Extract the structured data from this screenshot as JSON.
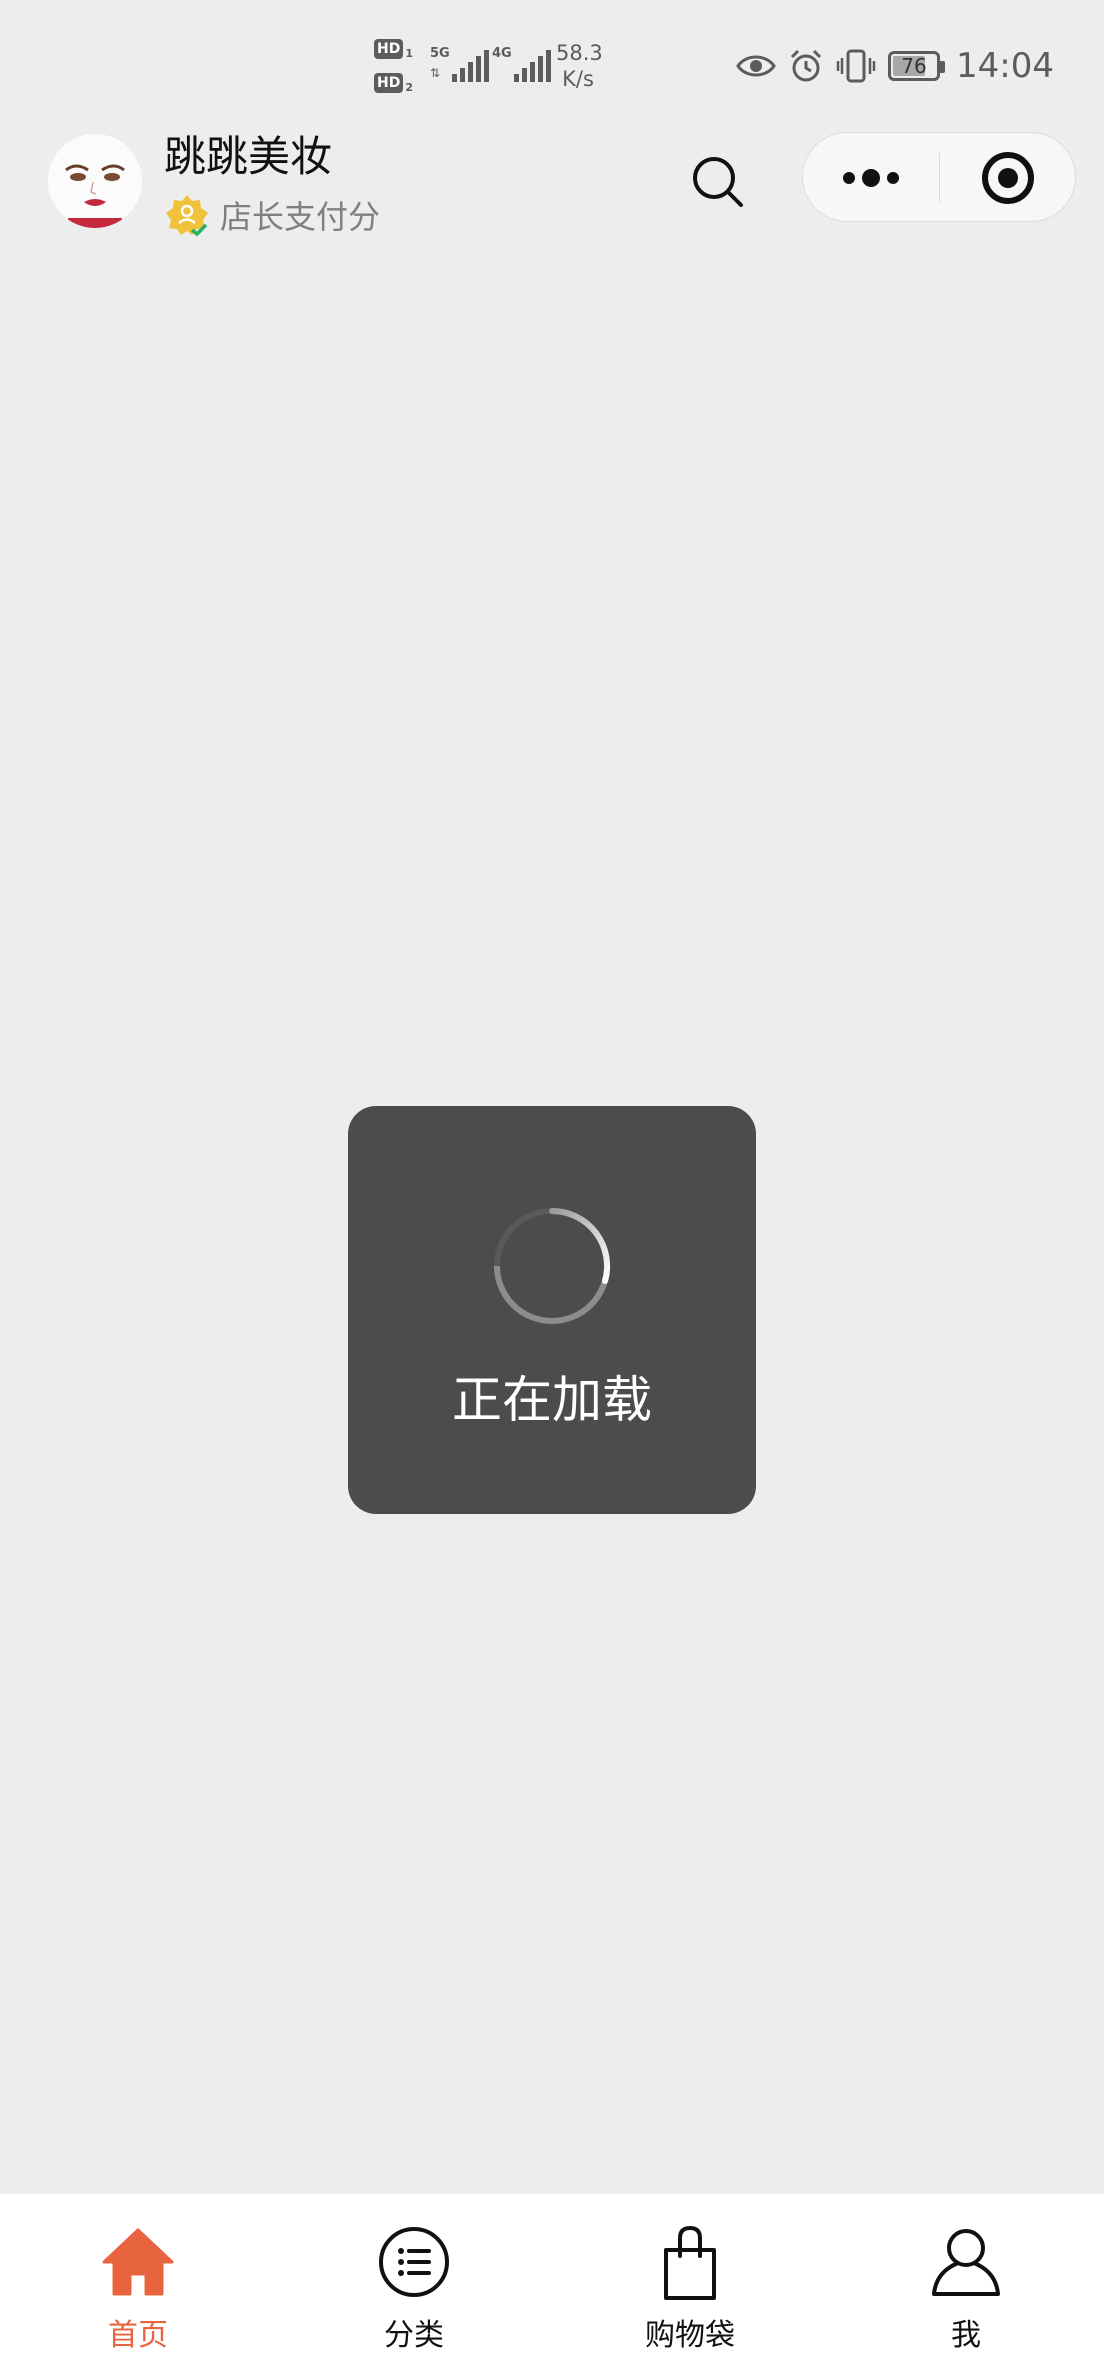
{
  "status_bar": {
    "sim1_label": "HD",
    "sim1_num": "1",
    "sim2_label": "HD",
    "sim2_num": "2",
    "net1_type": "5G",
    "net2_type": "4G",
    "speed_value": "58.3",
    "speed_unit": "K/s",
    "battery_percent": "76",
    "time": "14:04",
    "icons": [
      "eye-icon",
      "alarm-icon",
      "vibrate-icon",
      "battery-icon"
    ]
  },
  "header": {
    "shop_name": "跳跳美妆",
    "badge_text": "店长支付分",
    "search_icon": "search-icon",
    "more_icon": "more-dots-icon",
    "close_icon": "close-target-icon"
  },
  "loading": {
    "text": "正在加载"
  },
  "tabbar": {
    "active_color": "#e8643f",
    "tabs": [
      {
        "label": "首页",
        "icon": "home-icon",
        "active": true
      },
      {
        "label": "分类",
        "icon": "category-list-icon",
        "active": false
      },
      {
        "label": "购物袋",
        "icon": "shopping-bag-icon",
        "active": false
      },
      {
        "label": "我",
        "icon": "user-icon",
        "active": false
      }
    ]
  }
}
